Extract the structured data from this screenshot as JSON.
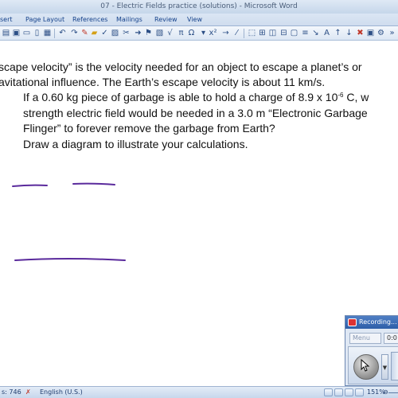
{
  "window": {
    "title": "07 - Electric Fields practice (solutions) - Microsoft Word"
  },
  "ribbon": {
    "tabs": [
      "sert",
      "Page Layout",
      "References",
      "Mailings",
      "Review",
      "View"
    ]
  },
  "toolbar": {
    "icons": [
      "paste-icon",
      "save-icon",
      "open-icon",
      "new-icon",
      "print-icon",
      "cut-icon",
      "undo-icon",
      "redo-icon",
      "spell-check-icon",
      "highlighter-icon",
      "pen-icon",
      "image-icon",
      "symbol-omega-icon",
      "pi-icon",
      "equation-icon",
      "table-icon",
      "arrow-icon"
    ],
    "symbols": [
      "π",
      "Ω"
    ]
  },
  "document": {
    "line1": "scape velocity” is the velocity needed for an object to escape a planet’s or",
    "line2": "avitational influence.  The Earth’s escape velocity is about 11 km/s.",
    "line3_pre": "If a 0.60 kg piece of garbage is able to hold a charge of 8.9 x 10",
    "line3_exp": "-6",
    "line3_post": " C, w",
    "line4": "strength electric field would be needed in a 3.0 m “Electronic Garbage",
    "line5": "Flinger” to forever remove the garbage from Earth?",
    "line6": "Draw a diagram to illustrate your calculations.",
    "ink_color": "#5a2a9c"
  },
  "statusbar": {
    "words": "s: 746",
    "language": "English (U.S.)",
    "zoom": "151%"
  },
  "recorder": {
    "title": "Recording...",
    "menu_label": "Menu",
    "time": "0:0"
  }
}
